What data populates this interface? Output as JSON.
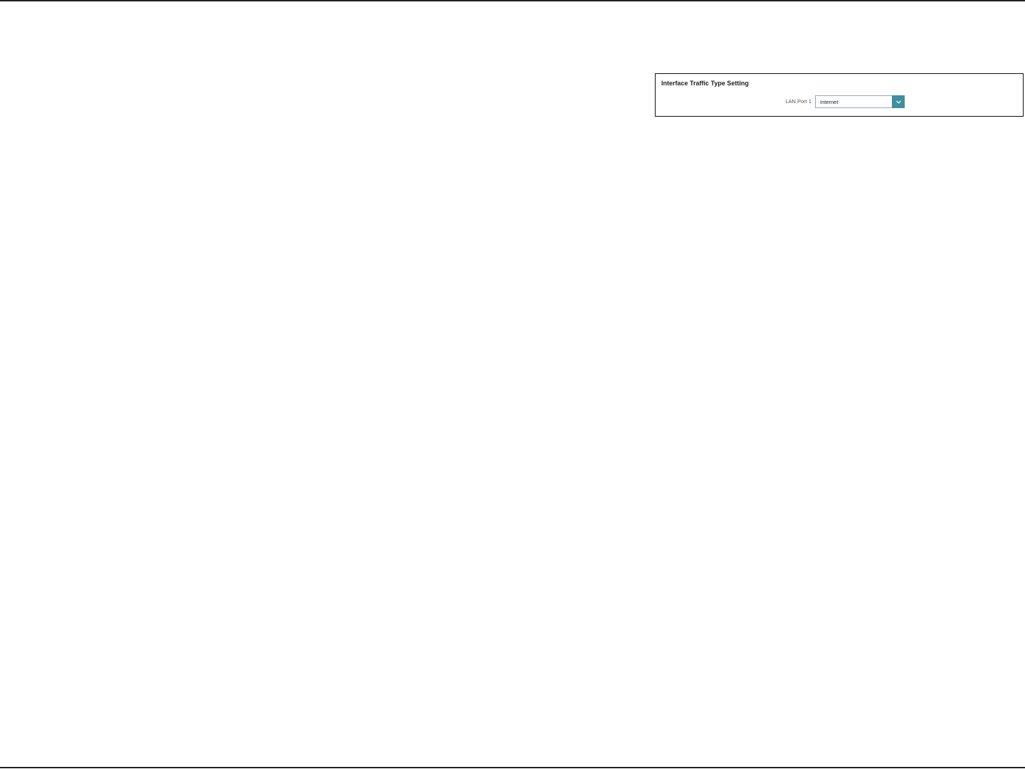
{
  "panel": {
    "title": "Interface Traffic Type Setting",
    "lan_port_1": {
      "label": "LAN Port 1",
      "selected_value": "Internet"
    }
  },
  "icons": {
    "dropdown": "chevron-down-icon"
  },
  "colors": {
    "dropdown_accent": "#3f8f9e",
    "border": "#111111"
  }
}
